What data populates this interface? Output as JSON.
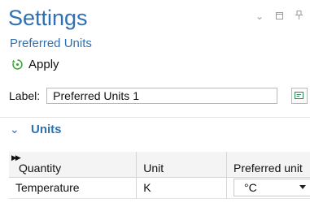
{
  "header": {
    "title": "Settings",
    "subtitle": "Preferred Units",
    "apply_label": "Apply",
    "icons": [
      "chevron-down-icon",
      "restore-icon",
      "pin-icon"
    ]
  },
  "label_row": {
    "label": "Label:",
    "value": "Preferred Units 1",
    "button_icon": "edit-label-icon"
  },
  "section": {
    "title": "Units",
    "icon": "chevron-down-icon"
  },
  "table": {
    "columns": [
      "Quantity",
      "Unit",
      "Preferred unit"
    ],
    "rows": [
      {
        "quantity": "Temperature",
        "unit": "K",
        "preferred_unit": "°C"
      }
    ]
  },
  "colors": {
    "accent": "#2f6fb3",
    "header_bg": "#f4f4f4",
    "border": "#d5d5d5"
  }
}
